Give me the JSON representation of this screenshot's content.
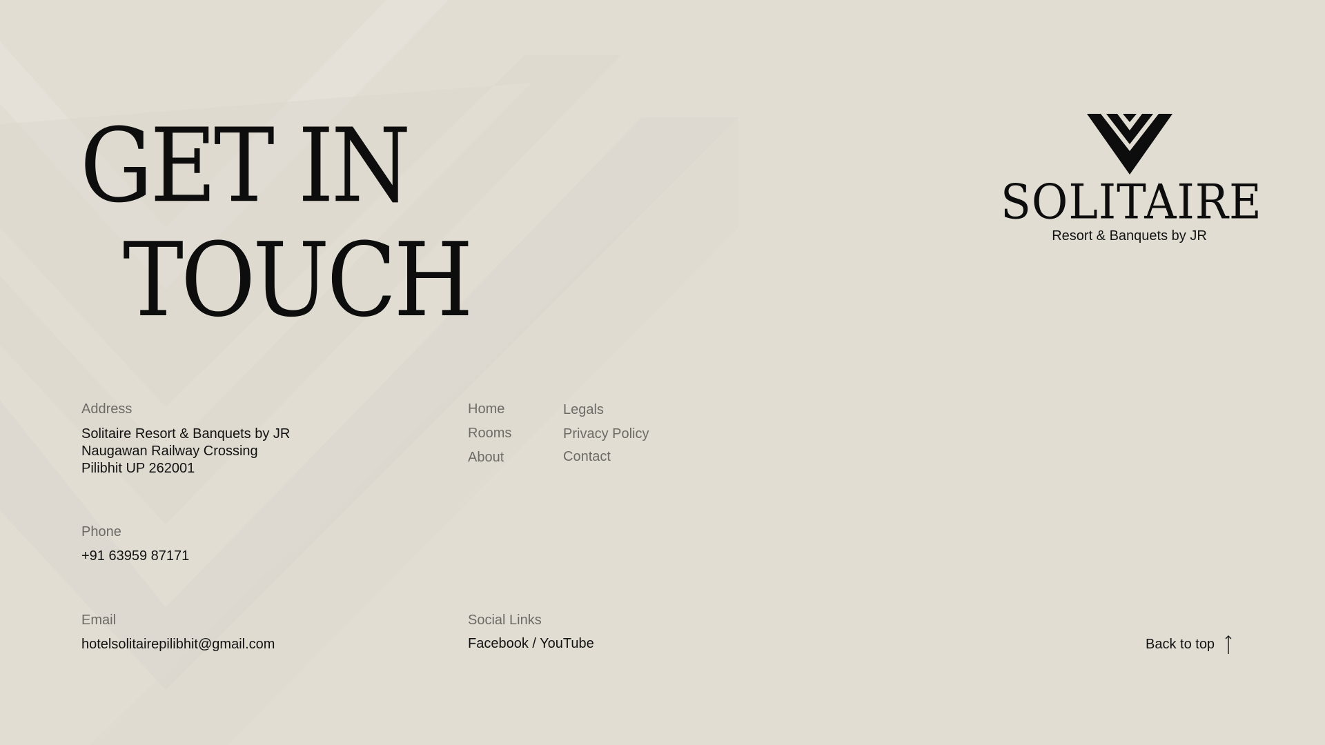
{
  "hero": {
    "line1": "GET IN",
    "line2": "TOUCH"
  },
  "brand": {
    "name": "SOLITAIRE",
    "tagline": "Resort & Banquets by JR",
    "logo_icon": "chevron-diamond-icon"
  },
  "address": {
    "label": "Address",
    "line1": "Solitaire Resort & Banquets by JR",
    "line2": "Naugawan Railway Crossing",
    "line3": "Pilibhit UP 262001"
  },
  "phone": {
    "label": "Phone",
    "value": "+91 63959 87171"
  },
  "email": {
    "label": "Email",
    "value": "hotelsolitairepilibhit@gmail.com"
  },
  "nav": {
    "col1": [
      "Home",
      "Rooms",
      "About"
    ],
    "col2": [
      "Legals",
      "Privacy Policy",
      "Contact"
    ]
  },
  "social": {
    "label": "Social Links",
    "facebook": "Facebook",
    "separator": " / ",
    "youtube": "YouTube"
  },
  "back_to_top": {
    "label": "Back to top",
    "icon": "arrow-up-icon"
  },
  "colors": {
    "background": "#e1ddd3",
    "text": "#121212",
    "muted": "#6d6b66"
  }
}
